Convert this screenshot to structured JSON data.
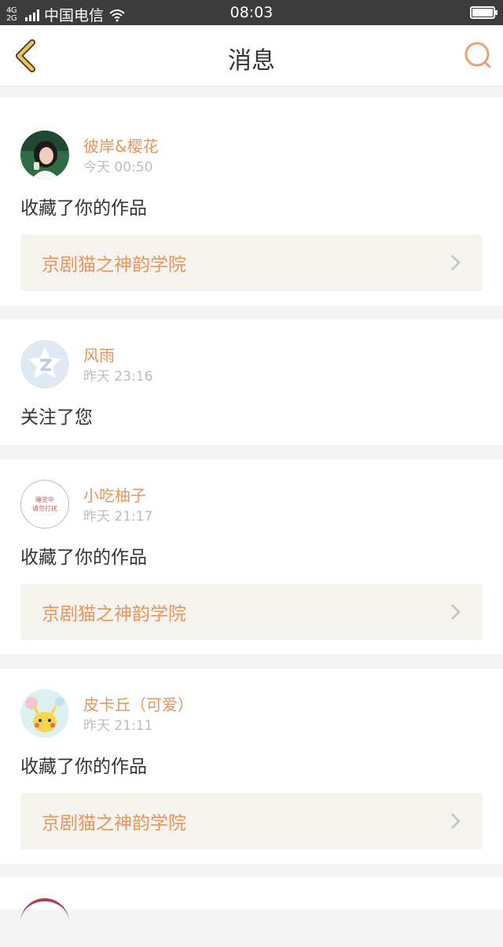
{
  "status_bar": {
    "network": "4G 2G",
    "carrier": "中国电信",
    "time": "08:03"
  },
  "header": {
    "title": "消息"
  },
  "messages": [
    {
      "username": "彼岸&樱花",
      "time": "今天 00:50",
      "action": "收藏了你的作品",
      "work_title": "京剧猫之神韵学院"
    },
    {
      "username": "风雨",
      "time": "昨天 23:16",
      "action": "关注了您"
    },
    {
      "username": "小吃柚子",
      "time": "昨天 21:17",
      "action": "收藏了你的作品",
      "work_title": "京剧猫之神韵学院",
      "avatar_text": [
        "睡觉中",
        "请勿打扰"
      ]
    },
    {
      "username": "皮卡丘（可爱）",
      "time": "昨天 21:11",
      "action": "收藏了你的作品",
      "work_title": "京剧猫之神韵学院"
    }
  ],
  "colors": {
    "accent": "#e8945f",
    "back_icon": "#f2c14e",
    "work_card_bg": "#f4f3ee"
  },
  "icons": [
    "back-icon",
    "search-icon",
    "chevron-right-icon",
    "wifi-icon",
    "signal-icon",
    "battery-icon"
  ]
}
